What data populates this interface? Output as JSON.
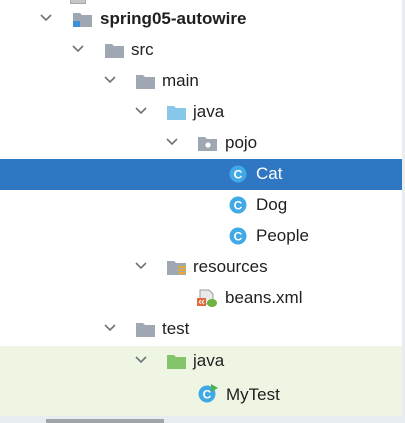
{
  "colors": {
    "selection": "#2f77c3",
    "test_area": "#eef6e3",
    "folder_grey": "#9fa8b2",
    "folder_java": "#86c7ea",
    "folder_test": "#84c56b",
    "class_icon": "#40a9e6"
  },
  "tree": {
    "project": {
      "label": "spring05-autowire",
      "icon": "module-folder-icon"
    },
    "src": {
      "label": "src",
      "icon": "folder-icon"
    },
    "main": {
      "label": "main",
      "icon": "folder-icon"
    },
    "main_java": {
      "label": "java",
      "icon": "source-folder-icon"
    },
    "pojo": {
      "label": "pojo",
      "icon": "package-icon"
    },
    "cat": {
      "label": "Cat",
      "icon": "class-icon",
      "badge": "C"
    },
    "dog": {
      "label": "Dog",
      "icon": "class-icon",
      "badge": "C"
    },
    "people": {
      "label": "People",
      "icon": "class-icon",
      "badge": "C"
    },
    "resources": {
      "label": "resources",
      "icon": "resources-folder-icon"
    },
    "beans": {
      "label": "beans.xml",
      "icon": "spring-xml-icon"
    },
    "test": {
      "label": "test",
      "icon": "folder-icon"
    },
    "test_java": {
      "label": "java",
      "icon": "test-source-folder-icon"
    },
    "mytest": {
      "label": "MyTest",
      "icon": "test-class-icon",
      "badge": "C"
    }
  }
}
